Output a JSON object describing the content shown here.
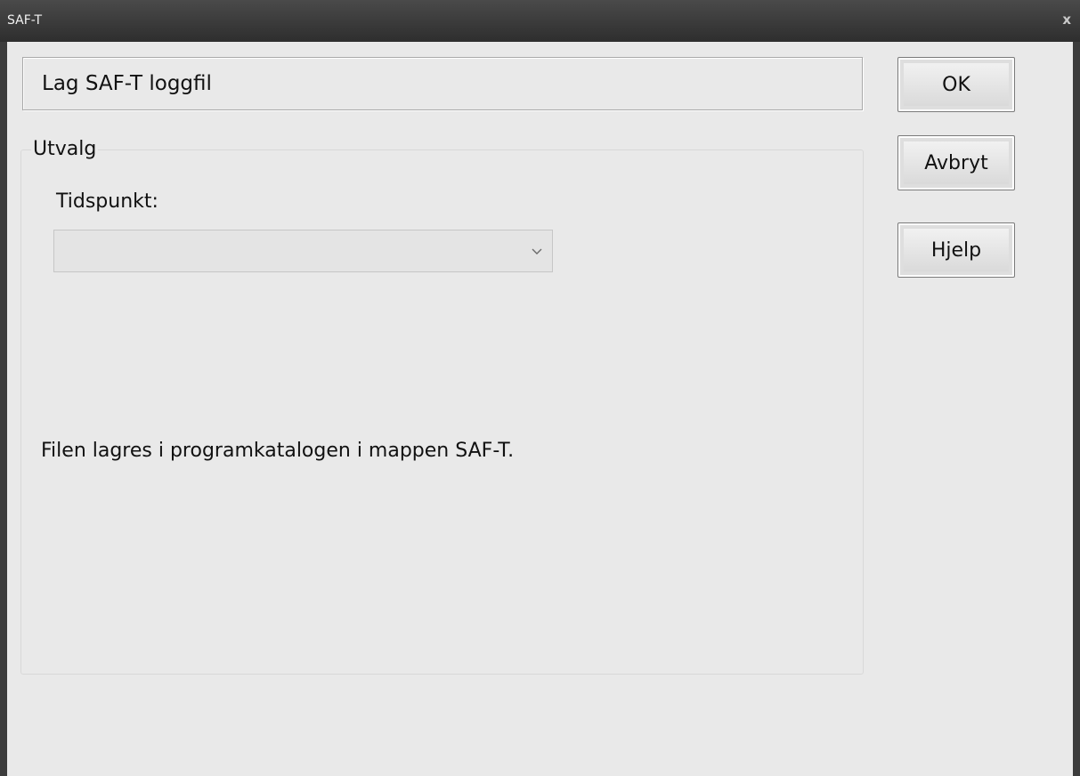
{
  "window": {
    "title": "SAF-T",
    "close_label": "x"
  },
  "header": {
    "title": "Lag SAF-T loggfil"
  },
  "selection": {
    "group_label": "Utvalg",
    "field_label": "Tidspunkt:",
    "combo_value": ""
  },
  "info": {
    "text": "Filen lagres i programkatalogen i mappen SAF-T."
  },
  "buttons": {
    "ok": "OK",
    "cancel": "Avbryt",
    "help": "Hjelp"
  },
  "icons": {
    "close": "close-icon",
    "dropdown": "chevron-down-icon"
  }
}
